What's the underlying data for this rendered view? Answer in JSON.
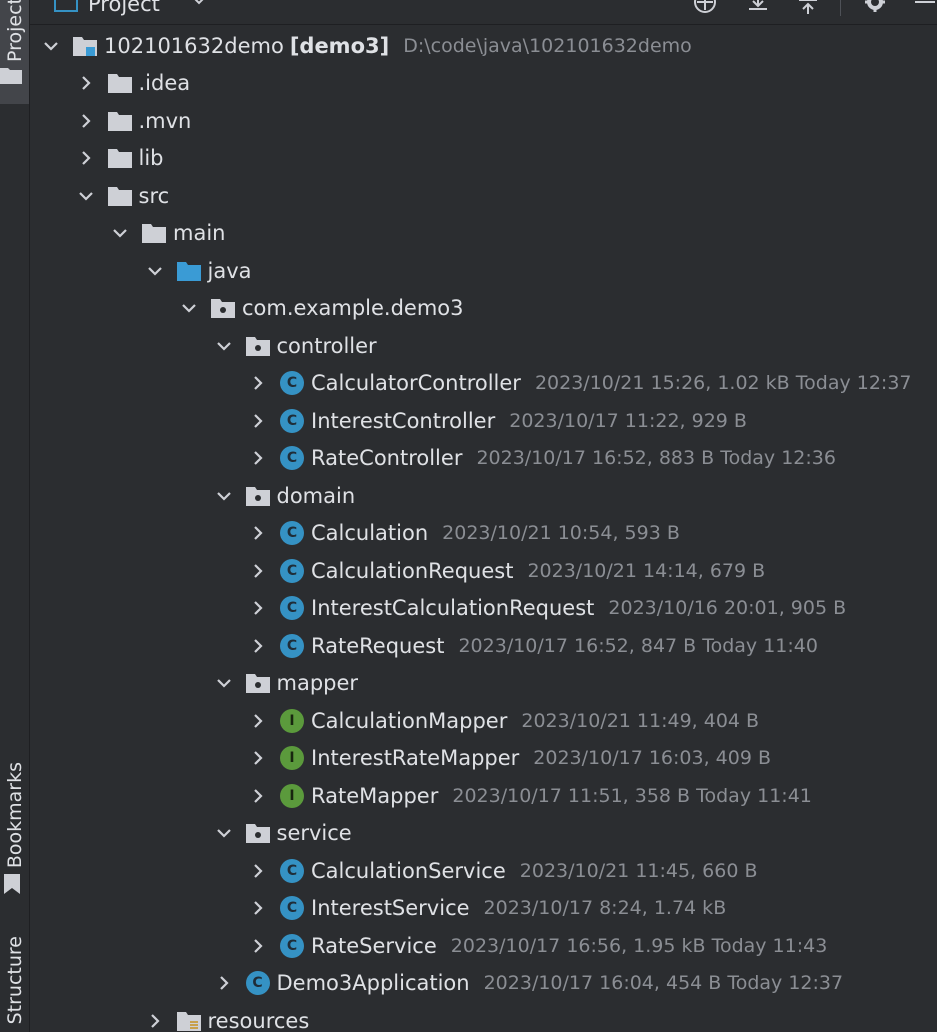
{
  "header": {
    "title": "Project"
  },
  "strip": {
    "project_label": "Project",
    "bookmarks_label": "Bookmarks",
    "structure_label": "Structure"
  },
  "tree": [
    {
      "depth": 0,
      "expanded": true,
      "icon": "module",
      "name": "102101632demo",
      "bold": "[demo3]",
      "meta": "D:\\code\\java\\102101632demo"
    },
    {
      "depth": 1,
      "expanded": false,
      "icon": "folder",
      "name": ".idea",
      "meta": ""
    },
    {
      "depth": 1,
      "expanded": false,
      "icon": "folder",
      "name": ".mvn",
      "meta": ""
    },
    {
      "depth": 1,
      "expanded": false,
      "icon": "folder",
      "name": "lib",
      "meta": ""
    },
    {
      "depth": 1,
      "expanded": true,
      "icon": "folder",
      "name": "src",
      "meta": ""
    },
    {
      "depth": 2,
      "expanded": true,
      "icon": "folder",
      "name": "main",
      "meta": ""
    },
    {
      "depth": 3,
      "expanded": true,
      "icon": "source-folder",
      "name": "java",
      "meta": ""
    },
    {
      "depth": 4,
      "expanded": true,
      "icon": "package",
      "name": "com.example.demo3",
      "meta": ""
    },
    {
      "depth": 5,
      "expanded": true,
      "icon": "package",
      "name": "controller",
      "meta": ""
    },
    {
      "depth": 6,
      "expanded": false,
      "icon": "class",
      "name": "CalculatorController",
      "meta": "2023/10/21 15:26, 1.02 kB Today 12:37"
    },
    {
      "depth": 6,
      "expanded": false,
      "icon": "class",
      "name": "InterestController",
      "meta": "2023/10/17 11:22, 929 B"
    },
    {
      "depth": 6,
      "expanded": false,
      "icon": "class",
      "name": "RateController",
      "meta": "2023/10/17 16:52, 883 B Today 12:36"
    },
    {
      "depth": 5,
      "expanded": true,
      "icon": "package",
      "name": "domain",
      "meta": ""
    },
    {
      "depth": 6,
      "expanded": false,
      "icon": "class",
      "name": "Calculation",
      "meta": "2023/10/21 10:54, 593 B"
    },
    {
      "depth": 6,
      "expanded": false,
      "icon": "class",
      "name": "CalculationRequest",
      "meta": "2023/10/21 14:14, 679 B"
    },
    {
      "depth": 6,
      "expanded": false,
      "icon": "class",
      "name": "InterestCalculationRequest",
      "meta": "2023/10/16 20:01, 905 B"
    },
    {
      "depth": 6,
      "expanded": false,
      "icon": "class",
      "name": "RateRequest",
      "meta": "2023/10/17 16:52, 847 B Today 11:40"
    },
    {
      "depth": 5,
      "expanded": true,
      "icon": "package",
      "name": "mapper",
      "meta": ""
    },
    {
      "depth": 6,
      "expanded": false,
      "icon": "interface",
      "name": "CalculationMapper",
      "meta": "2023/10/21 11:49, 404 B"
    },
    {
      "depth": 6,
      "expanded": false,
      "icon": "interface",
      "name": "InterestRateMapper",
      "meta": "2023/10/17 16:03, 409 B"
    },
    {
      "depth": 6,
      "expanded": false,
      "icon": "interface",
      "name": "RateMapper",
      "meta": "2023/10/17 11:51, 358 B Today 11:41"
    },
    {
      "depth": 5,
      "expanded": true,
      "icon": "package",
      "name": "service",
      "meta": ""
    },
    {
      "depth": 6,
      "expanded": false,
      "icon": "class",
      "name": "CalculationService",
      "meta": "2023/10/21 11:45, 660 B"
    },
    {
      "depth": 6,
      "expanded": false,
      "icon": "class",
      "name": "InterestService",
      "meta": "2023/10/17 8:24, 1.74 kB"
    },
    {
      "depth": 6,
      "expanded": false,
      "icon": "class",
      "name": "RateService",
      "meta": "2023/10/17 16:56, 1.95 kB Today 11:43"
    },
    {
      "depth": 5,
      "expanded": false,
      "icon": "class",
      "name": "Demo3Application",
      "meta": "2023/10/17 16:04, 454 B Today 12:37"
    },
    {
      "depth": 3,
      "expanded": false,
      "icon": "resources-folder",
      "name": "resources",
      "meta": ""
    }
  ]
}
